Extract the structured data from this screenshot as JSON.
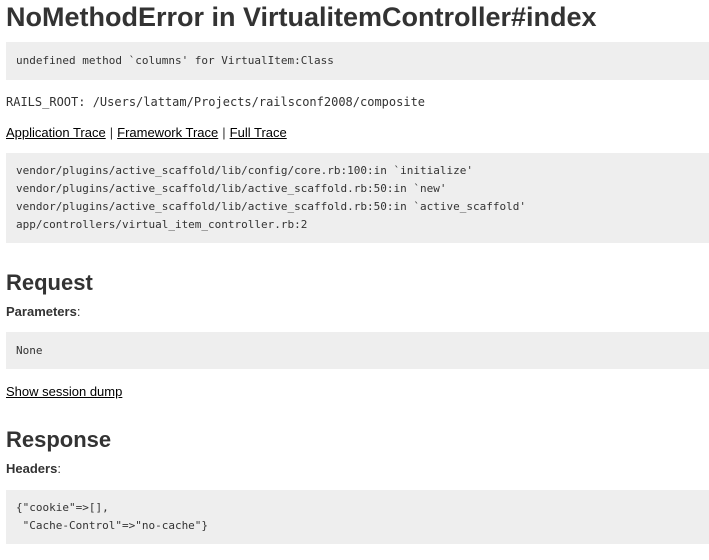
{
  "page_title": "NoMethodError in VirtualitemController#index",
  "error_message": "undefined method `columns' for VirtualItem:Class",
  "rails_root": "RAILS_ROOT: /Users/lattam/Projects/railsconf2008/composite",
  "trace_links": {
    "application": "Application Trace",
    "framework": "Framework Trace",
    "full": "Full Trace",
    "separator": "|"
  },
  "trace_lines": [
    "vendor/plugins/active_scaffold/lib/config/core.rb:100:in `initialize'",
    "vendor/plugins/active_scaffold/lib/active_scaffold.rb:50:in `new'",
    "vendor/plugins/active_scaffold/lib/active_scaffold.rb:50:in `active_scaffold'",
    "app/controllers/virtual_item_controller.rb:2"
  ],
  "request": {
    "heading": "Request",
    "params_label": "Parameters",
    "params_colon": ":",
    "params_value": "None",
    "session_link": "Show session dump"
  },
  "response": {
    "heading": "Response",
    "headers_label": "Headers",
    "headers_colon": ":",
    "headers_lines": [
      "{\"cookie\"=>[],",
      " \"Cache-Control\"=>\"no-cache\"}"
    ]
  }
}
